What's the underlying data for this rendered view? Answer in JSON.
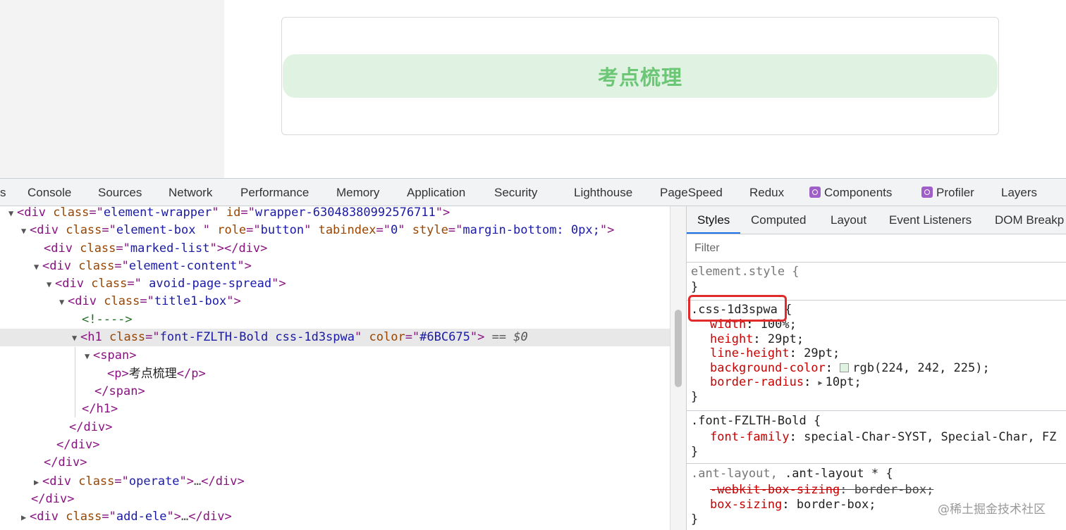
{
  "preview": {
    "title": "考点梳理",
    "accent_color": "#6BC675",
    "pill_bg": "#E0F2E1"
  },
  "devtools_tabs": [
    {
      "label": "s"
    },
    {
      "label": "Console"
    },
    {
      "label": "Sources"
    },
    {
      "label": "Network"
    },
    {
      "label": "Performance"
    },
    {
      "label": "Memory"
    },
    {
      "label": "Application"
    },
    {
      "label": "Security"
    },
    {
      "label": "Lighthouse"
    },
    {
      "label": "PageSpeed"
    },
    {
      "label": "Redux"
    },
    {
      "label": "Components",
      "icon": "react-icon"
    },
    {
      "label": "Profiler",
      "icon": "react-icon"
    },
    {
      "label": "Layers"
    }
  ],
  "dom": {
    "r0": {
      "tag": "div",
      "a1n": "class",
      "a1v": "element-wrapper",
      "a2n": "id",
      "a2v": "wrapper-63048380992576711"
    },
    "r1": {
      "tag": "div",
      "a1n": "class",
      "a1v": "element-box ",
      "a2n": "role",
      "a2v": "button",
      "a3n": "tabindex",
      "a3v": "0",
      "a4n": "style",
      "a4v": "margin-bottom: 0px;"
    },
    "r2": {
      "tag": "div",
      "a1n": "class",
      "a1v": "marked-list",
      "close": "div"
    },
    "r3": {
      "tag": "div",
      "a1n": "class",
      "a1v": "element-content"
    },
    "r4": {
      "tag": "div",
      "a1n": "class",
      "a1v": " avoid-page-spread"
    },
    "r5": {
      "tag": "div",
      "a1n": "class",
      "a1v": "title1-box"
    },
    "r6": {
      "comment": "<!---->"
    },
    "r7": {
      "tag": "h1",
      "a1n": "class",
      "a1v": "font-FZLTH-Bold css-1d3spwa",
      "a2n": "color",
      "a2v": "#6BC675",
      "suffix": "== $0"
    },
    "r8": {
      "tag": "span"
    },
    "r9": {
      "tag": "p",
      "text": "考点梳理",
      "close": "p"
    },
    "r10": {
      "close": "span"
    },
    "r11": {
      "close": "h1"
    },
    "r12": {
      "close": "div"
    },
    "r13": {
      "close": "div"
    },
    "r14": {
      "close": "div"
    },
    "r15": {
      "tag": "div",
      "a1n": "class",
      "a1v": "operate",
      "ellipsis": "…",
      "close": "div"
    },
    "r16": {
      "close": "div"
    },
    "r17": {
      "tag": "div",
      "a1n": "class",
      "a1v": "add-ele",
      "ellipsis": "…",
      "close": "div"
    }
  },
  "styles_tabs": [
    {
      "label": "Styles"
    },
    {
      "label": "Computed"
    },
    {
      "label": "Layout"
    },
    {
      "label": "Event Listeners"
    },
    {
      "label": "DOM Breakp"
    }
  ],
  "filter_placeholder": "Filter",
  "rules": {
    "element_style": {
      "selector": "element.style {",
      "close": "}"
    },
    "css1": {
      "selector": ".css-1d3spwa",
      "open": " {",
      "p1n": "width",
      "p1v": "100%;",
      "p2n": "height",
      "p2v": "29pt;",
      "p3n": "line-height",
      "p3v": "29pt;",
      "p4n": "background-color",
      "p4v": "rgb(224, 242, 225);",
      "p5n": "border-radius",
      "p5v": "10pt;",
      "close": "}"
    },
    "font": {
      "selector": ".font-FZLTH-Bold {",
      "p1n": "font-family",
      "p1v": "special-Char-SYST, Special-Char, FZ",
      "close": "}"
    },
    "ant": {
      "sel1": ".ant-layout,",
      "sel2": " .ant-layout * {",
      "p1n": "-webkit-box-sizing",
      "p1v": "border-box;",
      "p2n": "box-sizing",
      "p2v": "border-box;",
      "close": "}"
    }
  },
  "watermark": "@稀土掘金技术社区"
}
